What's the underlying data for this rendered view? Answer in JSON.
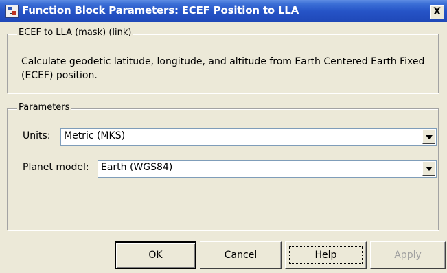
{
  "window": {
    "title": "Function Block Parameters: ECEF Position to LLA",
    "close_label": "X"
  },
  "mask_group": {
    "label": "ECEF to LLA (mask) (link)",
    "description": "Calculate geodetic latitude, longitude, and altitude from Earth Centered Earth Fixed (ECEF) position."
  },
  "params_group": {
    "label": "Parameters",
    "units": {
      "label": "Units:",
      "value": "Metric (MKS)"
    },
    "planet_model": {
      "label": "Planet model:",
      "value": "Earth (WGS84)"
    }
  },
  "buttons": {
    "ok": "OK",
    "cancel": "Cancel",
    "help": "Help",
    "apply": "Apply"
  },
  "colors": {
    "titlebar": "#2654c7",
    "dialog_bg": "#ece9d8",
    "disabled_text": "#a0a0a0"
  }
}
